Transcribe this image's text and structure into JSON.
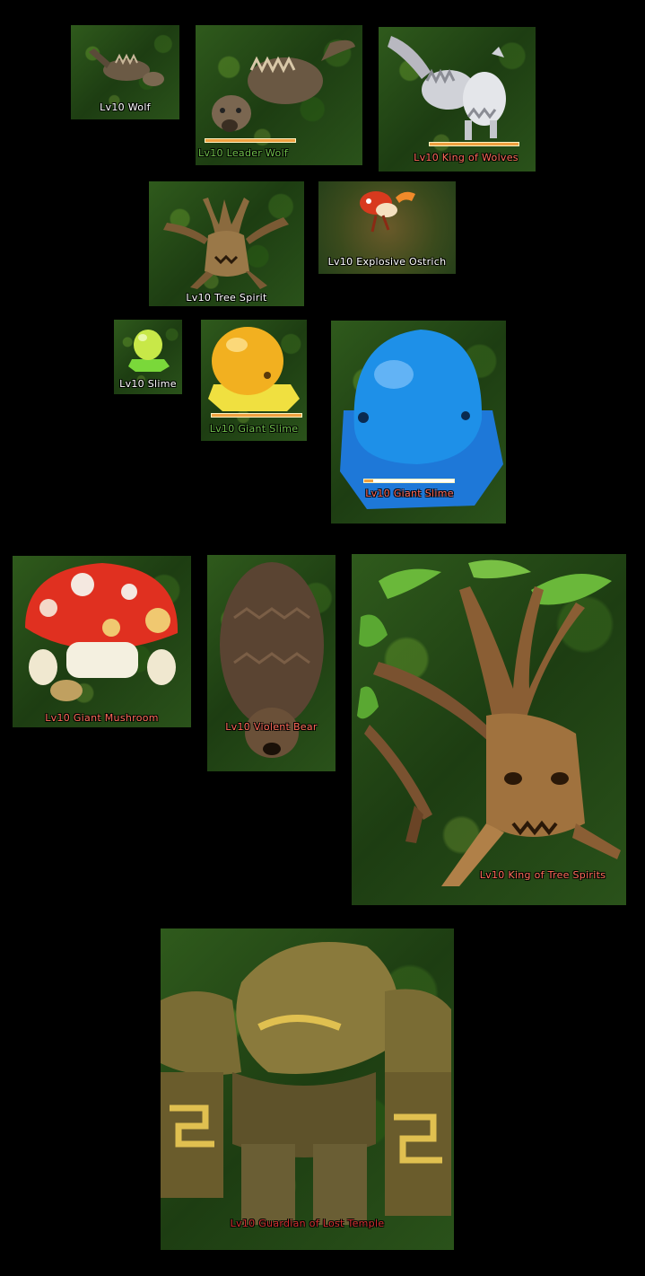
{
  "monsters": [
    {
      "label": "Lv10 Wolf",
      "label_color": "#ffffff",
      "icon": "wolf-icon"
    },
    {
      "label": "Lv10 Leader Wolf",
      "label_color": "#6fbf4a",
      "icon": "leader-wolf-icon",
      "hp": 1.0
    },
    {
      "label": "Lv10 King of Wolves",
      "label_color": "#ff6a5a",
      "icon": "king-wolf-icon",
      "hp": 1.0
    },
    {
      "label": "Lv10 Tree Spirit",
      "label_color": "#ffffff",
      "icon": "tree-spirit-icon"
    },
    {
      "label": "Lv10 Explosive Ostrich",
      "label_color": "#ffffff",
      "icon": "ostrich-icon"
    },
    {
      "label": "Lv10 Slime",
      "label_color": "#ffffff",
      "icon": "slime-icon"
    },
    {
      "label": "Lv10 Giant Slime",
      "label_color": "#6fbf4a",
      "icon": "giant-slime-icon",
      "hp": 1.0
    },
    {
      "label": "Lv10 Giant Slime",
      "label_color": "#ff6a5a",
      "icon": "blue-giant-slime-icon",
      "hp": 0.1
    },
    {
      "label": "Lv10 Giant Mushroom",
      "label_color": "#ff6a5a",
      "icon": "mushroom-icon"
    },
    {
      "label": "Lv10 Violent Bear",
      "label_color": "#ff6a5a",
      "icon": "bear-icon"
    },
    {
      "label": "Lv10 King of Tree Spirits",
      "label_color": "#ff6a5a",
      "icon": "tree-king-icon"
    },
    {
      "label": "Lv10 Guardian of Lost Temple",
      "label_color": "#d03030",
      "icon": "golem-icon"
    }
  ]
}
